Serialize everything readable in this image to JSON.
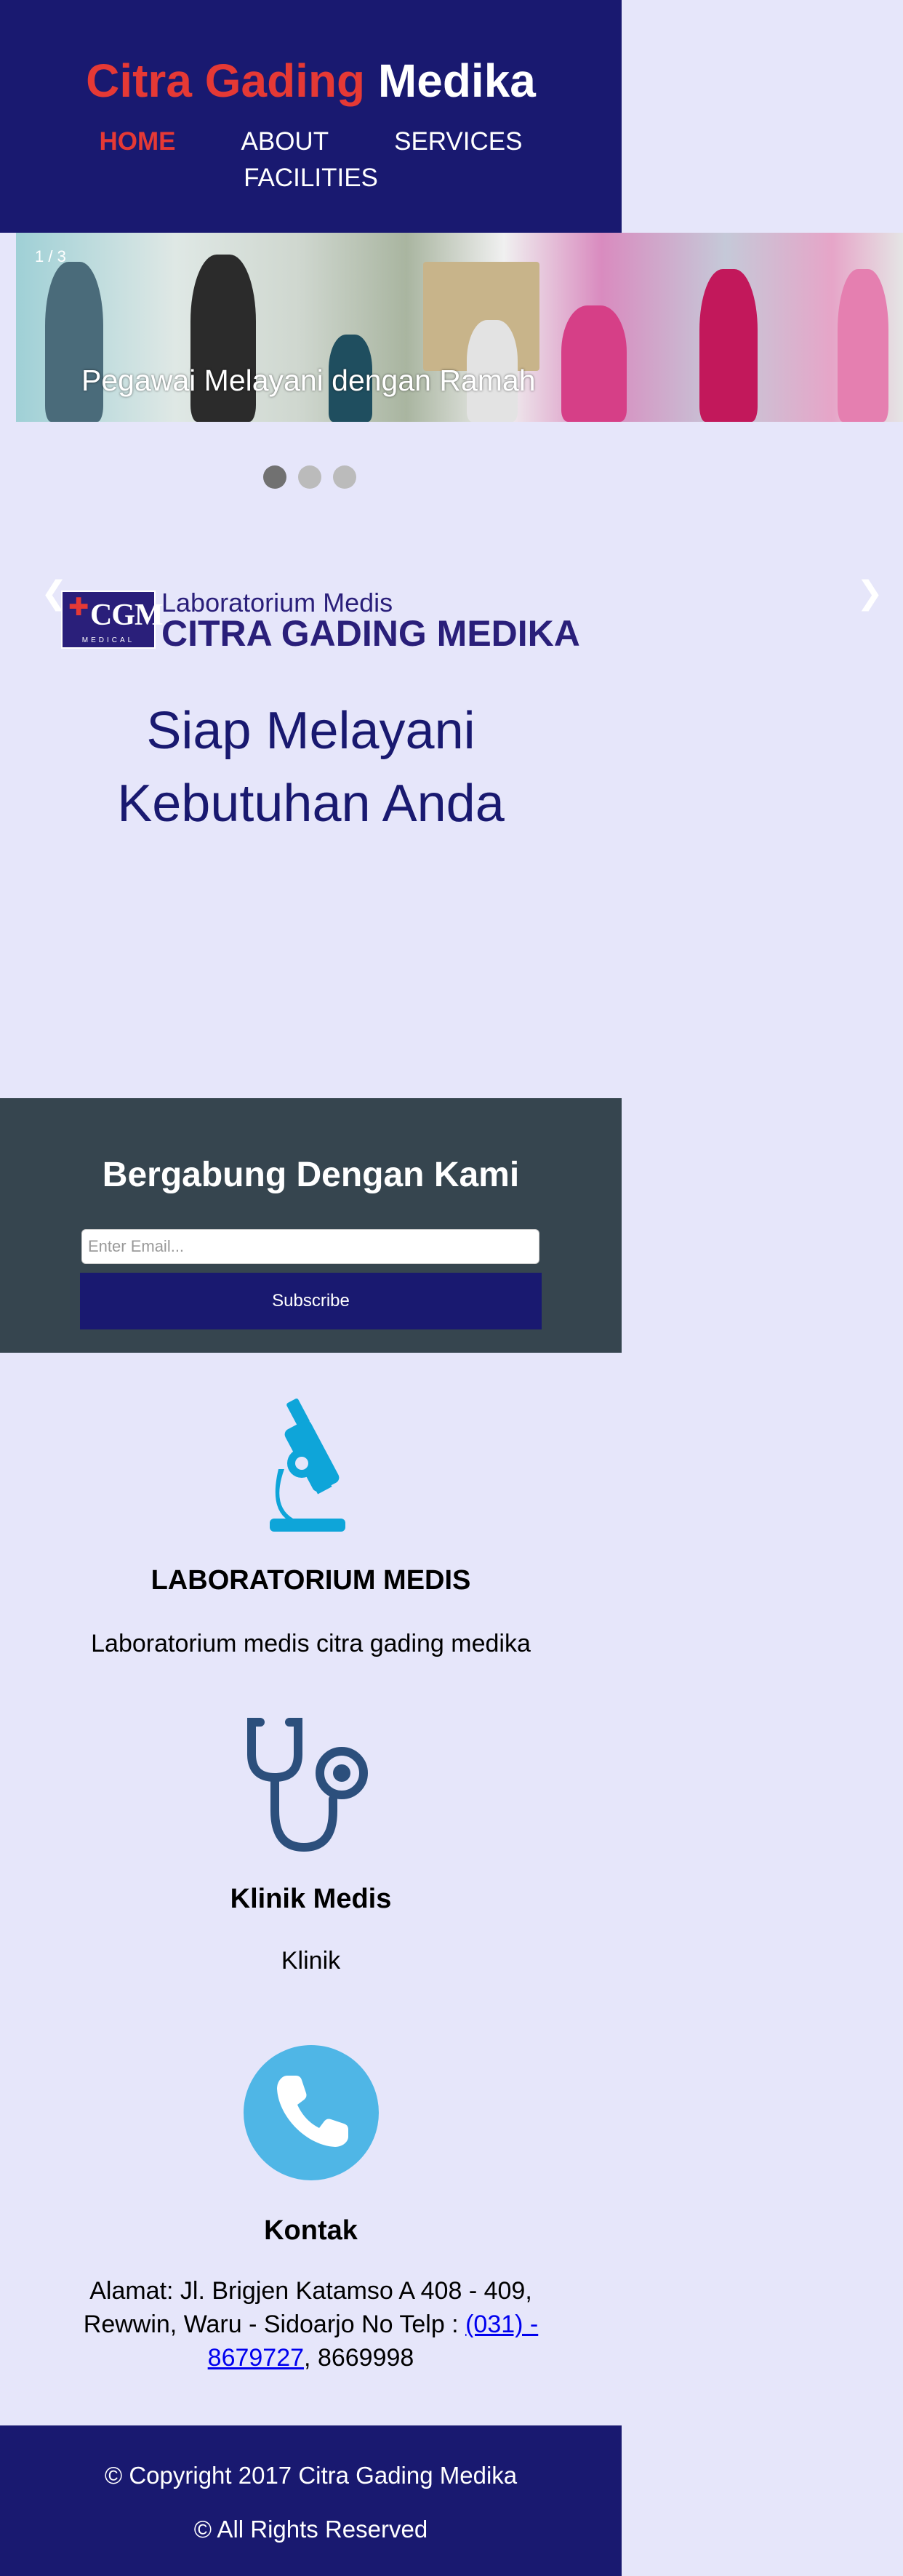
{
  "header": {
    "brand_part1": "Citra Gading",
    "brand_part2": "Medika",
    "nav": [
      "HOME",
      "ABOUT",
      "SERVICES",
      "FACILITIES"
    ]
  },
  "slider": {
    "counter": "1 / 3",
    "caption": "Pegawai Melayani dengan Ramah",
    "prev": "❮",
    "next": "❯",
    "dot_count": 3,
    "active_dot": 1
  },
  "lab": {
    "logo_text": "CGM",
    "logo_sub": "MEDICAL",
    "subtitle": "Laboratorium Medis",
    "title": "CITRA GADING MEDIKA"
  },
  "hero": {
    "line1": "Siap Melayani",
    "line2": "Kebutuhan Anda"
  },
  "subscribe": {
    "title": "Bergabung Dengan Kami",
    "placeholder": "Enter Email...",
    "button": "Subscribe"
  },
  "services": [
    {
      "icon": "microscope-icon",
      "title": "LABORATORIUM MEDIS",
      "text": "Laboratorium medis citra gading medika"
    },
    {
      "icon": "stethoscope-icon",
      "title": "Klinik Medis",
      "text": "Klinik"
    },
    {
      "icon": "phone-icon",
      "title": "Kontak",
      "address_line1": "Alamat: Jl. Brigjen Katamso A 408 - 409,",
      "address_line2": "Rewwin, Waru - Sidoarjo No Telp :",
      "phone_link_part1": "(031) -",
      "phone_link_part2": "8679727",
      "phone_rest": ", 8669998"
    }
  ],
  "footer": {
    "copyright": "© Copyright 2017 Citra Gading Medika",
    "rights": "© All Rights Reserved"
  },
  "colors": {
    "navy": "#191970",
    "accent_red": "#e53935",
    "page_bg": "#e6e6fa",
    "subscribe_bg": "#36454f",
    "microscope": "#0ea5d9",
    "stethoscope": "#2c4f7c",
    "phone_circle": "#4fb6e6"
  }
}
